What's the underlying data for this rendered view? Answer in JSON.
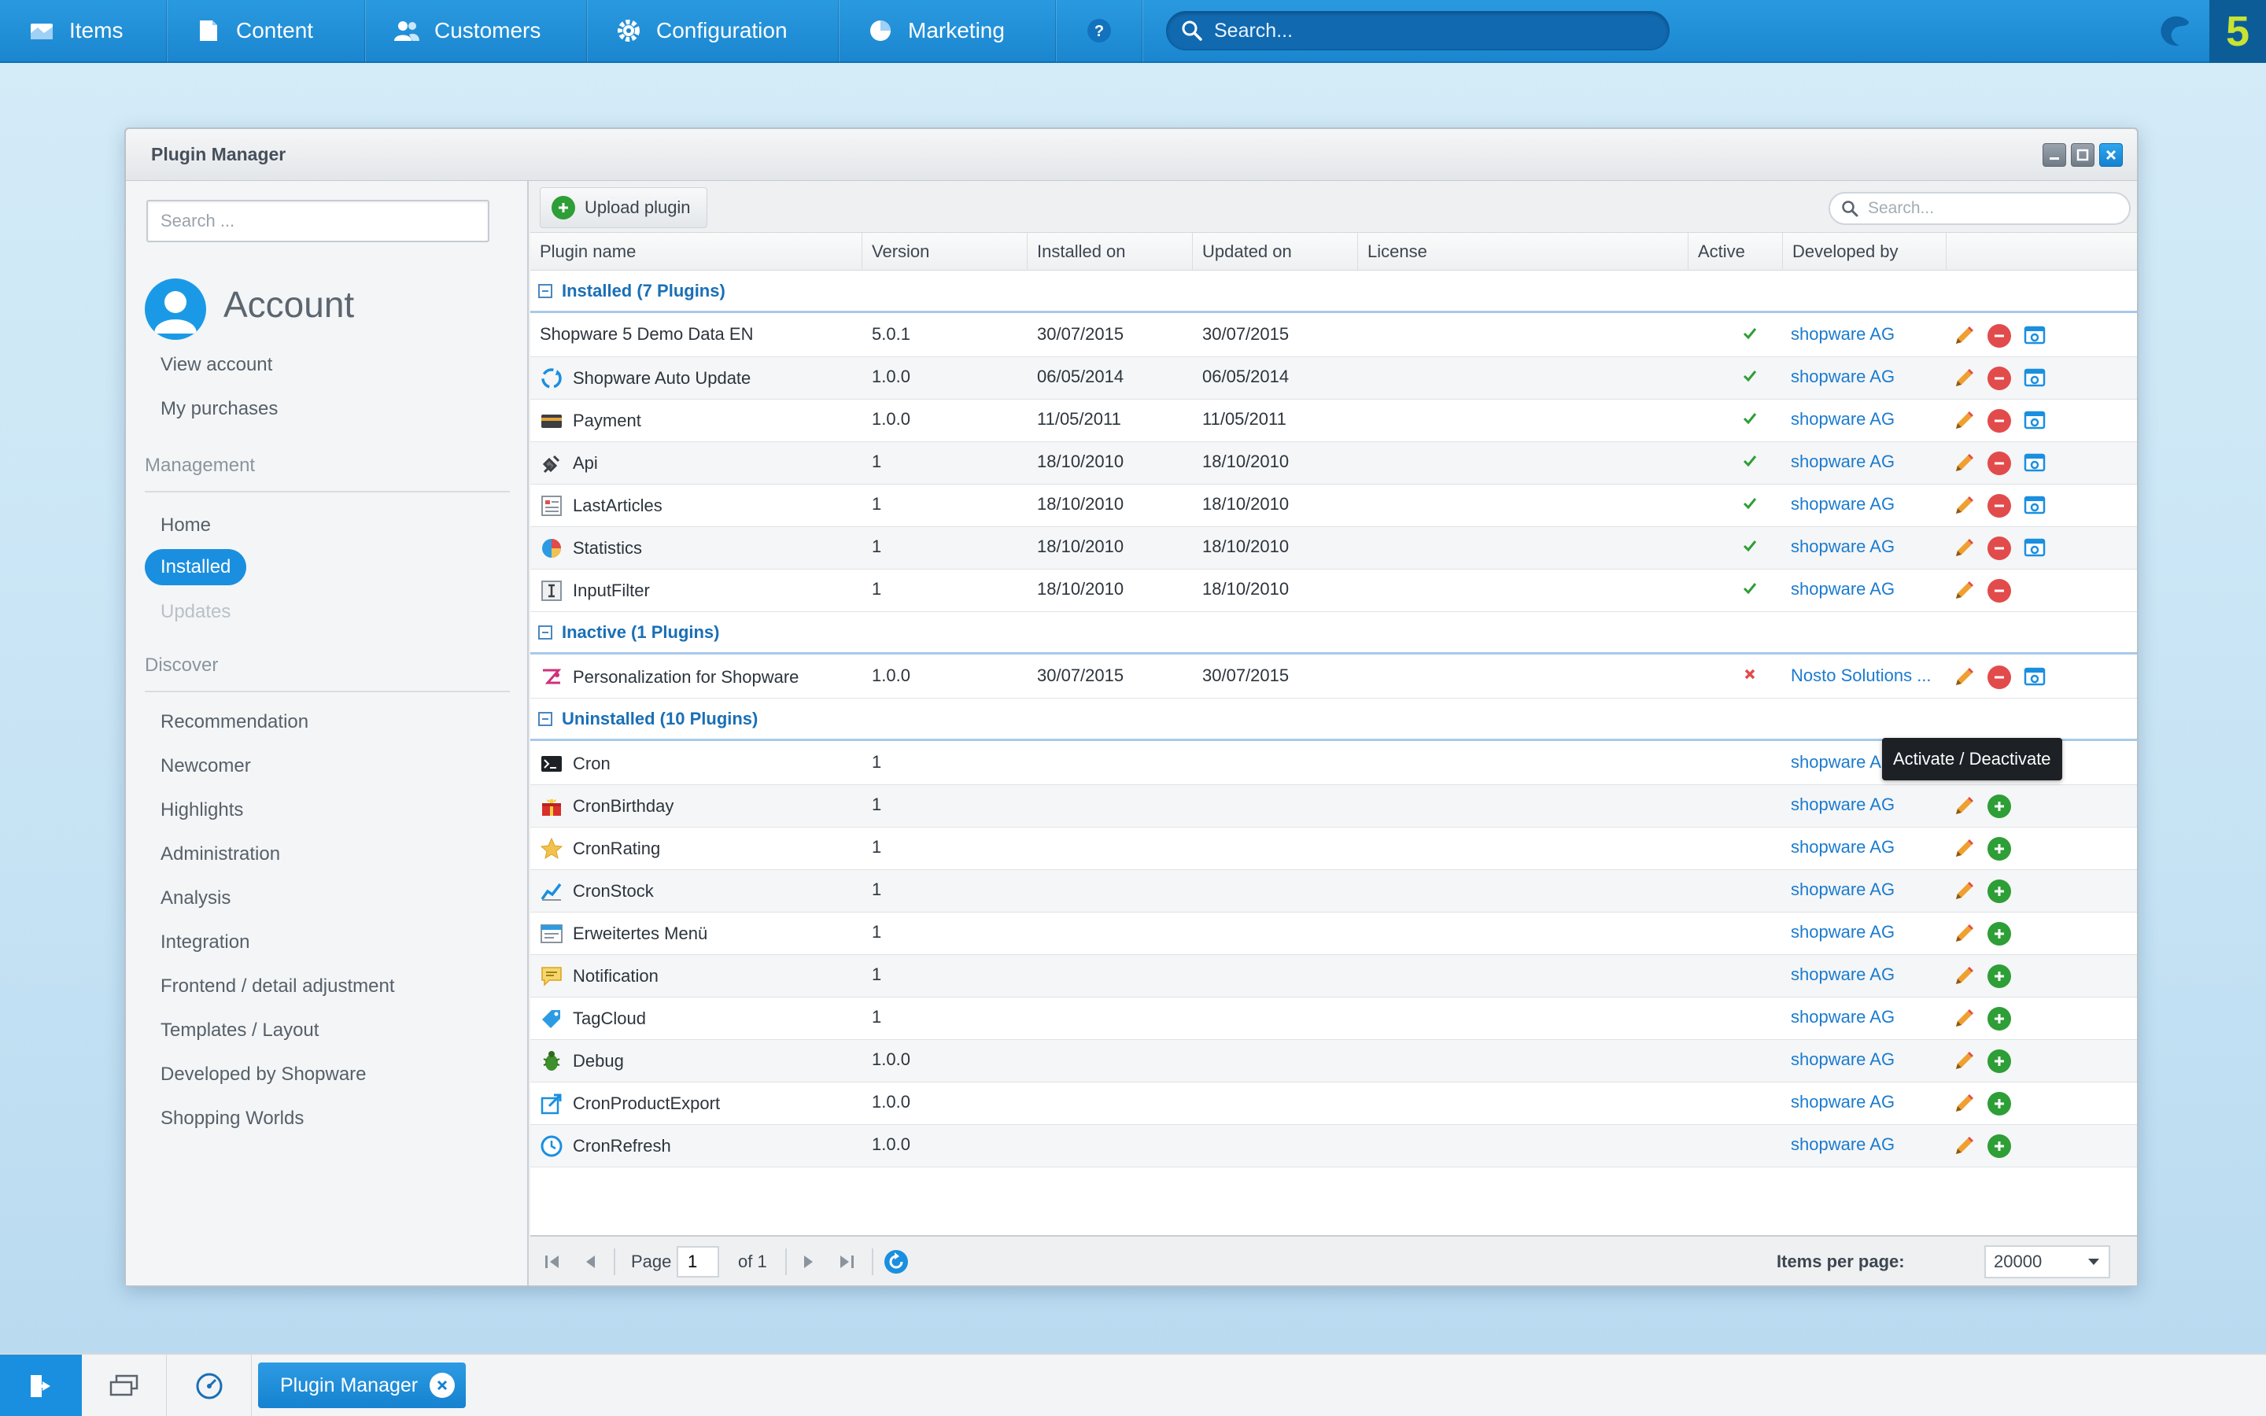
{
  "nav": {
    "items": [
      "Items",
      "Content",
      "Customers",
      "Configuration",
      "Marketing"
    ],
    "search_placeholder": "Search..."
  },
  "window": {
    "title": "Plugin Manager"
  },
  "sidebar": {
    "search_placeholder": "Search ...",
    "account_title": "Account",
    "account_links": [
      "View account",
      "My purchases"
    ],
    "management_title": "Management",
    "management_links": {
      "home": "Home",
      "installed": "Installed",
      "updates": "Updates"
    },
    "discover_title": "Discover",
    "discover_links": [
      "Recommendation",
      "Newcomer",
      "Highlights",
      "Administration",
      "Analysis",
      "Integration",
      "Frontend / detail adjustment",
      "Templates / Layout",
      "Developed by Shopware",
      "Shopping Worlds"
    ]
  },
  "toolbar": {
    "upload_label": "Upload plugin",
    "search_placeholder": "Search..."
  },
  "columns": [
    "Plugin name",
    "Version",
    "Installed on",
    "Updated on",
    "License",
    "Active",
    "Developed by"
  ],
  "groups": {
    "installed": "Installed (7 Plugins)",
    "inactive": "Inactive (1 Plugins)",
    "uninstalled": "Uninstalled (10 Plugins)"
  },
  "installed_rows": [
    {
      "name": "Shopware 5 Demo Data EN",
      "icon": "none",
      "version": "5.0.1",
      "installed": "30/07/2015",
      "updated": "30/07/2015",
      "dev": "shopware AG"
    },
    {
      "name": "Shopware Auto Update",
      "icon": "refresh-icon",
      "version": "1.0.0",
      "installed": "06/05/2014",
      "updated": "06/05/2014",
      "dev": "shopware AG"
    },
    {
      "name": "Payment",
      "icon": "credit-card-icon",
      "version": "1.0.0",
      "installed": "11/05/2011",
      "updated": "11/05/2011",
      "dev": "shopware AG"
    },
    {
      "name": "Api",
      "icon": "plug-icon",
      "version": "1",
      "installed": "18/10/2010",
      "updated": "18/10/2010",
      "dev": "shopware AG"
    },
    {
      "name": "LastArticles",
      "icon": "list-icon",
      "version": "1",
      "installed": "18/10/2010",
      "updated": "18/10/2010",
      "dev": "shopware AG"
    },
    {
      "name": "Statistics",
      "icon": "pie-chart-icon",
      "version": "1",
      "installed": "18/10/2010",
      "updated": "18/10/2010",
      "dev": "shopware AG"
    },
    {
      "name": "InputFilter",
      "icon": "text-field-icon",
      "version": "1",
      "installed": "18/10/2010",
      "updated": "18/10/2010",
      "dev": "shopware AG"
    }
  ],
  "inactive_rows": [
    {
      "name": "Personalization for Shopware",
      "icon": "nosto-icon",
      "version": "1.0.0",
      "installed": "30/07/2015",
      "updated": "30/07/2015",
      "dev": "Nosto Solutions ..."
    }
  ],
  "uninstalled_rows": [
    {
      "name": "Cron",
      "icon": "terminal-icon",
      "version": "1",
      "dev": "shopware AG"
    },
    {
      "name": "CronBirthday",
      "icon": "gift-icon",
      "version": "1",
      "dev": "shopware AG"
    },
    {
      "name": "CronRating",
      "icon": "star-icon",
      "version": "1",
      "dev": "shopware AG"
    },
    {
      "name": "CronStock",
      "icon": "line-chart-icon",
      "version": "1",
      "dev": "shopware AG"
    },
    {
      "name": "Erweitertes Menü",
      "icon": "menu-window-icon",
      "version": "1",
      "dev": "shopware AG"
    },
    {
      "name": "Notification",
      "icon": "speech-bubble-icon",
      "version": "1",
      "dev": "shopware AG"
    },
    {
      "name": "TagCloud",
      "icon": "tag-icon",
      "version": "1",
      "dev": "shopware AG"
    },
    {
      "name": "Debug",
      "icon": "bug-icon",
      "version": "1.0.0",
      "dev": "shopware AG"
    },
    {
      "name": "CronProductExport",
      "icon": "export-icon",
      "version": "1.0.0",
      "dev": "shopware AG"
    },
    {
      "name": "CronRefresh",
      "icon": "clock-icon",
      "version": "1.0.0",
      "dev": "shopware AG"
    }
  ],
  "tooltip": "Activate / Deactivate",
  "pager": {
    "page_label": "Page",
    "page_value": "1",
    "of_label": "of 1",
    "items_per_page_label": "Items per page:",
    "items_per_page_value": "20000"
  },
  "taskbar": {
    "tab_label": "Plugin Manager"
  },
  "colors": {
    "accent": "#1a8fe0",
    "link": "#1a7bd0",
    "active_check": "#2e9e36",
    "inactive_x": "#e24b4b"
  }
}
